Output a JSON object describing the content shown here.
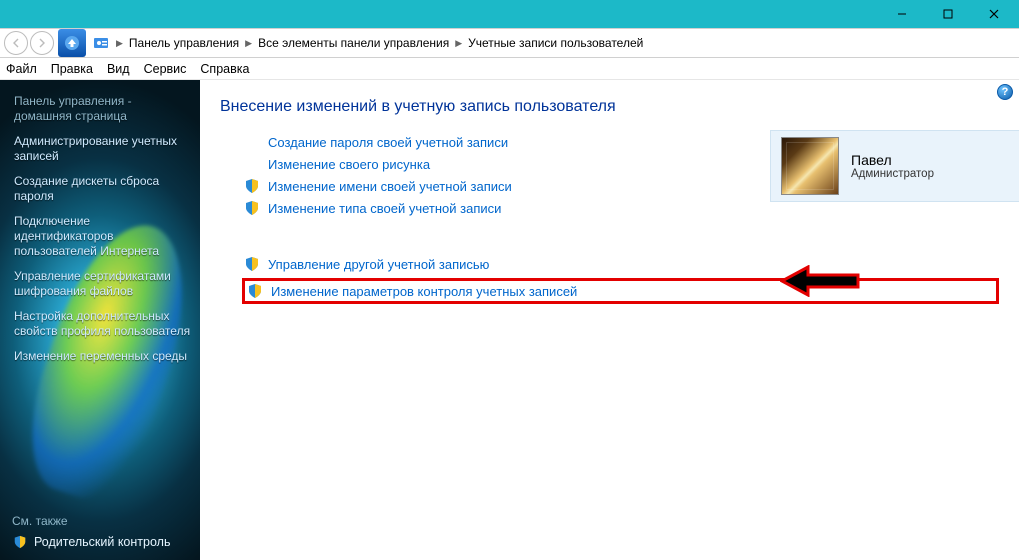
{
  "breadcrumb": {
    "root": "Панель управления",
    "middle": "Все элементы панели управления",
    "current": "Учетные записи пользователей"
  },
  "menu": {
    "file": "Файл",
    "edit": "Правка",
    "view": "Вид",
    "service": "Сервис",
    "help": "Справка"
  },
  "sidebar": {
    "home": "Панель управления - домашняя страница",
    "links": [
      "Администрирование учетных записей",
      "Создание дискеты сброса пароля",
      "Подключение идентификаторов пользователей Интернета",
      "Управление сертификатами шифрования файлов",
      "Настройка дополнительных свойств профиля пользователя",
      "Изменение переменных среды"
    ],
    "see_also": "См. также",
    "parental": "Родительский контроль"
  },
  "content": {
    "heading": "Внесение изменений в учетную запись пользователя",
    "links": {
      "create_password": "Создание пароля своей учетной записи",
      "change_picture": "Изменение своего рисунка",
      "change_name": "Изменение имени своей учетной записи",
      "change_type": "Изменение типа своей учетной записи",
      "manage_other": "Управление другой учетной записью",
      "change_uac": "Изменение параметров контроля учетных записей"
    }
  },
  "user": {
    "name": "Павел",
    "role": "Администратор"
  }
}
